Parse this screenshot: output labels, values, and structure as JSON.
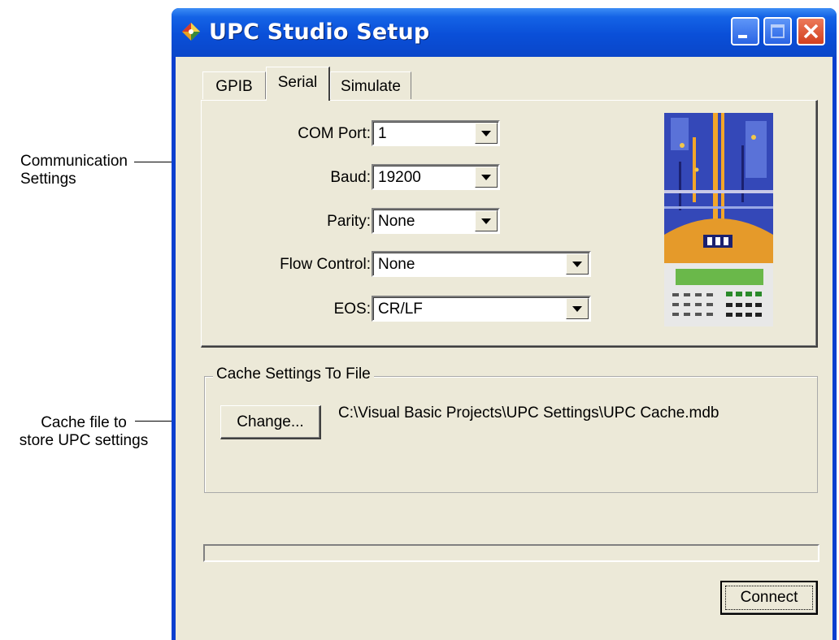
{
  "annotations": {
    "comm_line1": "Communication",
    "comm_line2": "Settings",
    "cache_line1": "Cache file to",
    "cache_line2": "store UPC settings"
  },
  "window": {
    "title": "UPC Studio Setup",
    "controls": [
      "minimize-icon",
      "maximize-icon",
      "close-icon"
    ]
  },
  "tabs": [
    {
      "label": "GPIB",
      "active": false
    },
    {
      "label": "Serial",
      "active": true
    },
    {
      "label": "Simulate",
      "active": false
    }
  ],
  "serial": {
    "com_port": {
      "label": "COM Port:",
      "value": "1"
    },
    "baud": {
      "label": "Baud:",
      "value": "19200"
    },
    "parity": {
      "label": "Parity:",
      "value": "None"
    },
    "flow_control": {
      "label": "Flow Control:",
      "value": "None"
    },
    "eos": {
      "label": "EOS:",
      "value": "CR/LF"
    }
  },
  "cache": {
    "group_title": "Cache Settings To File",
    "change_label": "Change...",
    "path": "C:\\Visual Basic Projects\\UPC Settings\\UPC Cache.mdb"
  },
  "progress": {
    "value": 0
  },
  "footer": {
    "connect_label": "Connect"
  },
  "colors": {
    "titlebar": "#0a4fd8",
    "dialog_bg": "#ece9d8",
    "close_button": "#d2401f"
  }
}
